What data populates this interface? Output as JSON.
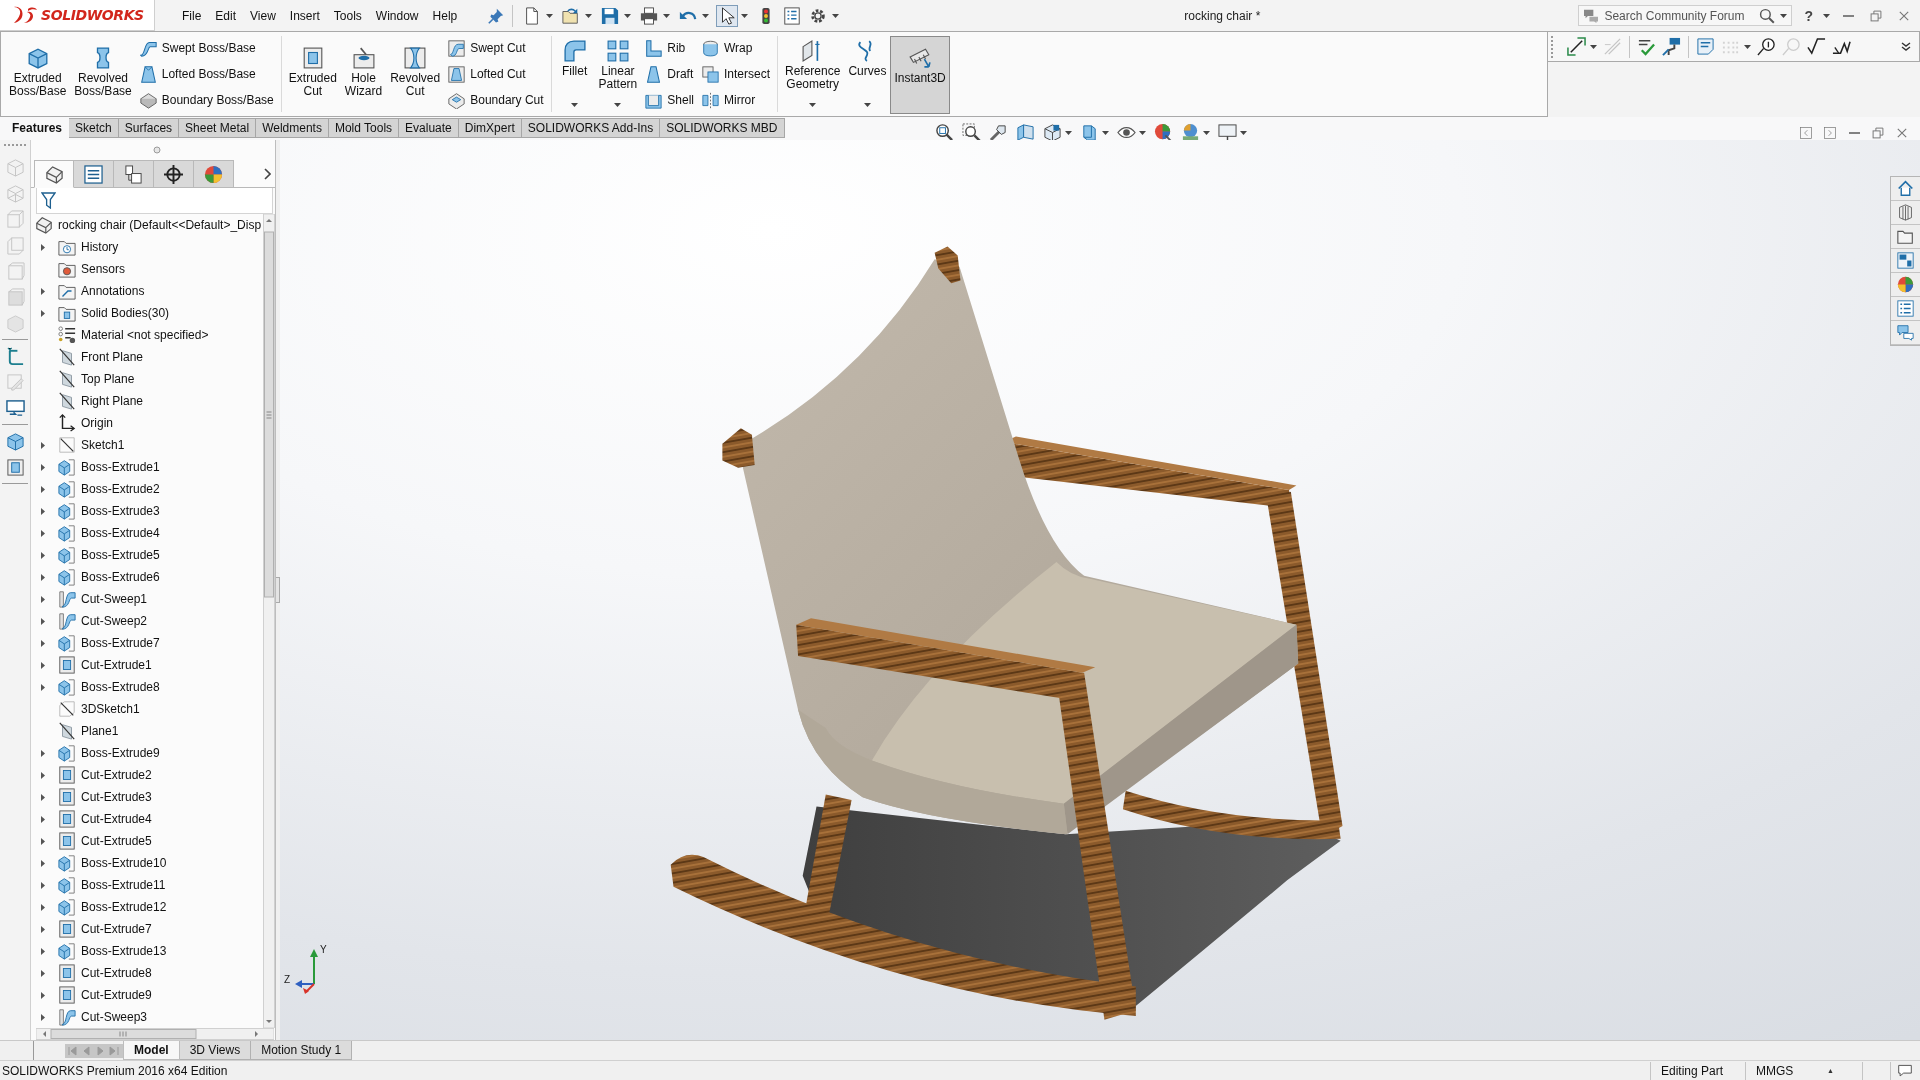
{
  "title_bar": {
    "logo": "SOLIDWORKS",
    "menu": [
      "File",
      "Edit",
      "View",
      "Insert",
      "Tools",
      "Window",
      "Help"
    ],
    "quick_access": [
      {
        "pressed": false
      },
      {
        "pressed": false
      },
      {
        "pressed": false
      },
      {
        "pressed": false
      },
      {
        "pressed": false
      },
      {
        "pressed": true
      },
      {
        "pressed": false
      },
      {
        "pressed": false
      },
      {
        "pressed": false
      }
    ],
    "document_title": "rocking chair *",
    "search": {
      "placeholder": "Search Community Forum"
    },
    "help": "?"
  },
  "command_manager": {
    "groups": [
      {
        "large": [
          {
            "label": "Extruded Boss/Base",
            "dropdown": false,
            "pressed": false
          },
          {
            "label": "Revolved Boss/Base",
            "dropdown": false,
            "pressed": false
          }
        ],
        "stacks": [
          [
            "Swept Boss/Base",
            "Lofted Boss/Base",
            "Boundary Boss/Base"
          ]
        ]
      },
      {
        "large": [
          {
            "label": "Extruded Cut",
            "dropdown": false,
            "pressed": false
          },
          {
            "label": "Hole Wizard",
            "dropdown": false,
            "pressed": false
          },
          {
            "label": "Revolved Cut",
            "dropdown": false,
            "pressed": false
          }
        ],
        "stacks": [
          [
            "Swept Cut",
            "Lofted Cut",
            "Boundary Cut"
          ]
        ]
      },
      {
        "large": [
          {
            "label": "Fillet",
            "dropdown": true,
            "pressed": false
          },
          {
            "label": "Linear Pattern",
            "dropdown": true,
            "pressed": false
          }
        ],
        "stacks": [
          [
            "Rib",
            "Draft",
            "Shell"
          ],
          [
            "Wrap",
            "Intersect",
            "Mirror"
          ]
        ]
      },
      {
        "large": [
          {
            "label": "Reference Geometry",
            "dropdown": true,
            "pressed": false
          },
          {
            "label": "Curves",
            "dropdown": true,
            "pressed": false
          },
          {
            "label": "Instant3D",
            "dropdown": false,
            "pressed": true
          }
        ]
      }
    ],
    "tabs": [
      {
        "label": "Features",
        "selected": true
      },
      {
        "label": "Sketch",
        "selected": false
      },
      {
        "label": "Surfaces",
        "selected": false
      },
      {
        "label": "Sheet Metal",
        "selected": false
      },
      {
        "label": "Weldments",
        "selected": false
      },
      {
        "label": "Mold Tools",
        "selected": false
      },
      {
        "label": "Evaluate",
        "selected": false
      },
      {
        "label": "DimXpert",
        "selected": false
      },
      {
        "label": "SOLIDWORKS Add-Ins",
        "selected": false
      },
      {
        "label": "SOLIDWORKS MBD",
        "selected": false
      }
    ]
  },
  "annotation_toolbar": [
    {
      "disabled": false
    },
    {
      "disabled": true
    },
    {
      "disabled": false
    },
    {
      "disabled": false
    },
    {
      "disabled": false
    },
    {
      "disabled": true
    },
    {
      "disabled": false
    },
    {
      "disabled": true
    },
    {
      "disabled": false
    },
    {
      "disabled": false
    }
  ],
  "view_tools": [
    [
      {
        "disabled": true
      },
      {
        "disabled": true
      },
      {
        "disabled": true
      },
      {
        "disabled": true
      },
      {
        "disabled": true
      },
      {
        "disabled": true
      },
      {
        "disabled": true
      }
    ],
    [
      {
        "disabled": false
      },
      {
        "disabled": true
      },
      {
        "disabled": false
      }
    ],
    [
      {
        "disabled": false
      },
      {
        "disabled": false
      }
    ]
  ],
  "feature_manager": {
    "tabs": [
      {
        "selected": true
      },
      {
        "selected": false
      },
      {
        "selected": false
      },
      {
        "selected": false
      },
      {
        "selected": false
      }
    ],
    "root": "rocking chair (Default<<Default>_Disp",
    "items": [
      {
        "label": "History",
        "kind": "history",
        "expandable": true
      },
      {
        "label": "Sensors",
        "kind": "sensors",
        "expandable": false
      },
      {
        "label": "Annotations",
        "kind": "annotations",
        "expandable": true
      },
      {
        "label": "Solid Bodies(30)",
        "kind": "bodies",
        "expandable": true
      },
      {
        "label": "Material <not specified>",
        "kind": "material",
        "expandable": false
      },
      {
        "label": "Front Plane",
        "kind": "plane",
        "expandable": false
      },
      {
        "label": "Top Plane",
        "kind": "plane",
        "expandable": false
      },
      {
        "label": "Right Plane",
        "kind": "plane",
        "expandable": false
      },
      {
        "label": "Origin",
        "kind": "origin",
        "expandable": false
      },
      {
        "label": "Sketch1",
        "kind": "sketch",
        "expandable": true
      },
      {
        "label": "Boss-Extrude1",
        "kind": "boss",
        "expandable": true
      },
      {
        "label": "Boss-Extrude2",
        "kind": "boss",
        "expandable": true
      },
      {
        "label": "Boss-Extrude3",
        "kind": "boss",
        "expandable": true
      },
      {
        "label": "Boss-Extrude4",
        "kind": "boss",
        "expandable": true
      },
      {
        "label": "Boss-Extrude5",
        "kind": "boss",
        "expandable": true
      },
      {
        "label": "Boss-Extrude6",
        "kind": "boss",
        "expandable": true
      },
      {
        "label": "Cut-Sweep1",
        "kind": "sweep",
        "expandable": true
      },
      {
        "label": "Cut-Sweep2",
        "kind": "sweep",
        "expandable": true
      },
      {
        "label": "Boss-Extrude7",
        "kind": "boss",
        "expandable": true
      },
      {
        "label": "Cut-Extrude1",
        "kind": "cut",
        "expandable": true
      },
      {
        "label": "Boss-Extrude8",
        "kind": "boss",
        "expandable": true
      },
      {
        "label": "3DSketch1",
        "kind": "sketch3d",
        "expandable": false
      },
      {
        "label": "Plane1",
        "kind": "plane",
        "expandable": false
      },
      {
        "label": "Boss-Extrude9",
        "kind": "boss",
        "expandable": true
      },
      {
        "label": "Cut-Extrude2",
        "kind": "cut",
        "expandable": true
      },
      {
        "label": "Cut-Extrude3",
        "kind": "cut",
        "expandable": true
      },
      {
        "label": "Cut-Extrude4",
        "kind": "cut",
        "expandable": true
      },
      {
        "label": "Cut-Extrude5",
        "kind": "cut",
        "expandable": true
      },
      {
        "label": "Boss-Extrude10",
        "kind": "boss",
        "expandable": true
      },
      {
        "label": "Boss-Extrude11",
        "kind": "boss",
        "expandable": true
      },
      {
        "label": "Boss-Extrude12",
        "kind": "boss",
        "expandable": true
      },
      {
        "label": "Cut-Extrude7",
        "kind": "cut",
        "expandable": true
      },
      {
        "label": "Boss-Extrude13",
        "kind": "boss",
        "expandable": true
      },
      {
        "label": "Cut-Extrude8",
        "kind": "cut",
        "expandable": true
      },
      {
        "label": "Cut-Extrude9",
        "kind": "cut",
        "expandable": true
      },
      {
        "label": "Cut-Sweep3",
        "kind": "sweep",
        "expandable": true
      }
    ]
  },
  "triad_labels": [
    "Y",
    "Z"
  ],
  "bottom_tabs": [
    {
      "label": "Model",
      "selected": true
    },
    {
      "label": "3D Views",
      "selected": false
    },
    {
      "label": "Motion Study 1",
      "selected": false
    }
  ],
  "status_bar": {
    "edition": "SOLIDWORKS Premium 2016 x64 Edition",
    "mode": "Editing Part",
    "units": "MMGS",
    "units_menu": "▲"
  }
}
